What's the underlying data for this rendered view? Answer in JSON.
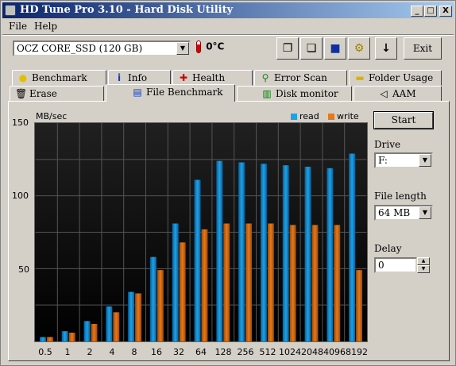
{
  "window": {
    "title": "HD Tune Pro 3.10 - Hard Disk Utility",
    "controls": {
      "minimize": "_",
      "maximize": "□",
      "close": "X"
    }
  },
  "menu": {
    "file": "File",
    "help": "Help"
  },
  "toolbar": {
    "drive": "OCZ CORE_SSD (120 GB)",
    "temperature": "0°C",
    "exit_label": "Exit",
    "icons": [
      "copy-icon",
      "copy-alt-icon",
      "save-icon",
      "options-icon",
      "download-icon"
    ]
  },
  "tabs": {
    "row1": [
      {
        "label": "Benchmark",
        "icon": "lightbulb-icon"
      },
      {
        "label": "Info",
        "icon": "info-icon"
      },
      {
        "label": "Health",
        "icon": "cross-icon"
      },
      {
        "label": "Error Scan",
        "icon": "magnifier-icon"
      },
      {
        "label": "Folder Usage",
        "icon": "folder-icon"
      }
    ],
    "row2": [
      {
        "label": "Erase",
        "icon": "trash-icon"
      },
      {
        "label": "File Benchmark",
        "icon": "file-icon"
      },
      {
        "label": "Disk monitor",
        "icon": "chart-icon"
      },
      {
        "label": "AAM",
        "icon": "speaker-icon"
      }
    ],
    "active": "File Benchmark"
  },
  "controls": {
    "start_label": "Start",
    "drive_label": "Drive",
    "drive_value": "F:",
    "file_length_label": "File length",
    "file_length_value": "64 MB",
    "delay_label": "Delay",
    "delay_value": "0"
  },
  "chart_data": {
    "type": "bar",
    "ylabel": "MB/sec",
    "ylim": [
      0,
      150
    ],
    "yticks": [
      50,
      100,
      150
    ],
    "categories": [
      "0.5",
      "1",
      "2",
      "4",
      "8",
      "16",
      "32",
      "64",
      "128",
      "256",
      "512",
      "1024",
      "2048",
      "4096",
      "8192"
    ],
    "series": [
      {
        "name": "read",
        "color": "#1aa3e8",
        "values": [
          3,
          7,
          14,
          24,
          34,
          58,
          81,
          111,
          124,
          123,
          122,
          121,
          120,
          119,
          129
        ]
      },
      {
        "name": "write",
        "color": "#e87818",
        "values": [
          3,
          6,
          12,
          20,
          33,
          49,
          68,
          77,
          81,
          81,
          81,
          80,
          80,
          80,
          49
        ]
      }
    ],
    "legend_position": "top-right",
    "grid": true
  }
}
